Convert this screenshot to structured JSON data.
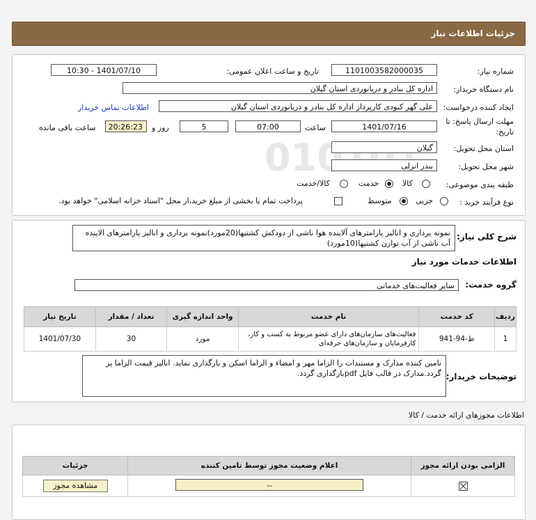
{
  "header": {
    "title": "جزئیات اطلاعات نیاز"
  },
  "form": {
    "need_number_label": "شماره نیاز:",
    "need_number": "1101003582000035",
    "announce_label": "تاریخ و ساعت اعلان عمومی:",
    "announce_value": "1401/07/10 - 10:30",
    "buyer_org_label": "نام دستگاه خریدار:",
    "buyer_org": "اداره کل بنادر و دریانوردی استان گیلان",
    "requester_label": "ایجاد کننده درخواست:",
    "requester": "علی  گهر کبودی کارپرداز اداره کل بنادر و دریانوردی استان گیلان",
    "contact_link": "اطلاعات تماس خریدار",
    "deadline_label": "مهلت ارسال پاسخ: تا",
    "deadline_label2": "تاریخ:",
    "deadline_date": "1401/07/16",
    "time_label": "ساعت",
    "deadline_time": "07:00",
    "days_value": "5",
    "days_label": "روز و",
    "remaining_time": "20:26:23",
    "remaining_label": "ساعت باقی مانده",
    "province_label": "استان محل تحویل:",
    "province": "گیلان",
    "city_label": "شهر محل تحویل:",
    "city": "بندر انزلی",
    "category_label": "طبقه بندی موضوعی:",
    "category_options": [
      "کالا",
      "خدمت",
      "کالا/خدمت"
    ],
    "category_selected": "خدمت",
    "purchase_type_label": "نوع فرآیند خرید :",
    "purchase_options": [
      "جزیی",
      "متوسط"
    ],
    "purchase_selected": "متوسط",
    "treasury_note": "پرداخت تمام یا بخشی از مبلغ خرید،از محل \"اسناد خزانه اسلامی\" خواهد بود."
  },
  "summary": {
    "label": "شرح کلی نیاز:",
    "text": "نمونه برداری و انالیز پارامترهای آلاینده هوا ناشی از دودکش کشتیها(20مورد)نمونه برداری و انالیز پارامترهای الاینده آب ناشی از آب توازن کشتیها(10مورد)"
  },
  "services": {
    "title": "اطلاعات خدمات مورد نیاز",
    "group_label": "گروه خدمت:",
    "group_value": "سایر فعالیت‌های خدماتی",
    "columns": [
      "ردیف",
      "کد خدمت",
      "نام خدمت",
      "واحد اندازه گیری",
      "تعداد / مقدار",
      "تاریخ نیاز"
    ],
    "rows": [
      [
        "1",
        "ط-94-941",
        "فعالیت‌های سازمان‌های دارای عضو مربوط به کسب و کار، کارفرمایان و سازمان‌های حرفه‌ای",
        "مورد",
        "30",
        "1401/07/30"
      ]
    ]
  },
  "buyer_notes": {
    "label": "توضیحات خریدار:",
    "text": "تامین کننده مدارک و مستندات را الزاما مهر و امضاء و الزاما اسکن و بارگذاری نماید. انالیز قیمت الزاما پر گردد.مدارک در قالب فایل pdfبارگذاری گردد."
  },
  "permits": {
    "title": "اطلاعات مجوزهای ارائه خدمت / کالا",
    "columns": [
      "الزامی بودن ارائه مجوز",
      "اعلام وضعیت مجوز توسط تامین کننده",
      "جزئیات"
    ],
    "status_value": "--",
    "view_button": "مشاهده مجوز"
  },
  "colors": {
    "header": "#8a6a45",
    "highlight": "#f7f0c8",
    "link": "#1a3bb5"
  }
}
